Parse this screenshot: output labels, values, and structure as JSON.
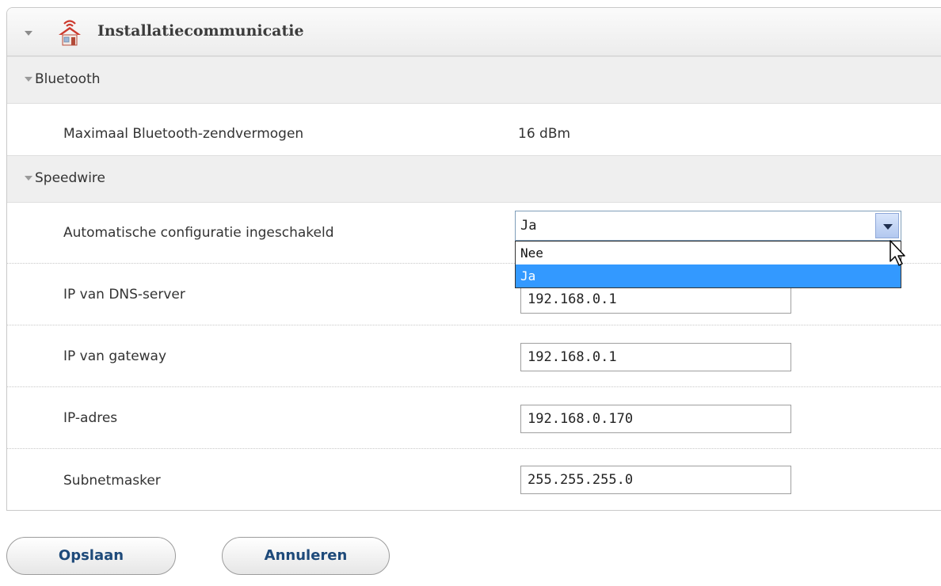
{
  "panel": {
    "title": "Installatiecommunicatie"
  },
  "bluetooth": {
    "section_label": "Bluetooth",
    "max_power_label": "Maximaal Bluetooth-zendvermogen",
    "max_power_value": "16  dBm"
  },
  "speedwire": {
    "section_label": "Speedwire",
    "auto_config_label": "Automatische configuratie ingeschakeld",
    "auto_config_value": "Ja",
    "auto_config_options": [
      "Nee",
      "Ja"
    ],
    "dns_label": "IP van DNS-server",
    "dns_value": "192.168.0.1",
    "gateway_label": "IP van gateway",
    "gateway_value": "192.168.0.1",
    "ip_label": "IP-adres",
    "ip_value": "192.168.0.170",
    "subnet_label": "Subnetmasker",
    "subnet_value": "255.255.255.0"
  },
  "buttons": {
    "save": "Opslaan",
    "cancel": "Annuleren"
  },
  "colors": {
    "accent": "#1e4a7a",
    "selection": "#3399ff",
    "icon": "#cc3a2e"
  }
}
